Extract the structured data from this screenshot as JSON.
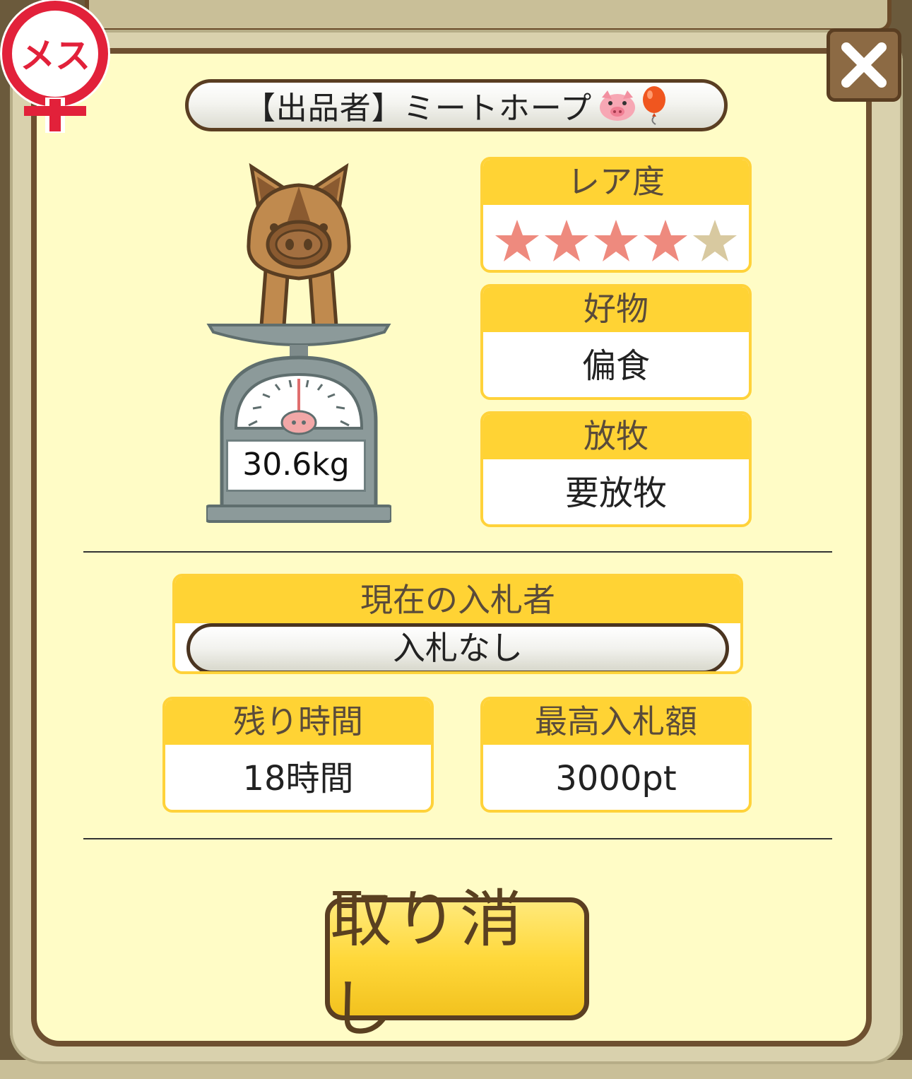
{
  "seller": {
    "label": "【出品者】ミートホープ"
  },
  "gender": {
    "label": "メス"
  },
  "animal": {
    "weight": "30.6kg"
  },
  "rarity": {
    "title": "レア度",
    "stars_filled": 4,
    "stars_total": 5
  },
  "favorite": {
    "title": "好物",
    "value": "偏食"
  },
  "grazing": {
    "title": "放牧",
    "value": "要放牧"
  },
  "bidder": {
    "title": "現在の入札者",
    "value": "入札なし"
  },
  "time_left": {
    "title": "残り時間",
    "value": "18時間"
  },
  "max_bid": {
    "title": "最高入札額",
    "value": "3000pt"
  },
  "actions": {
    "cancel_label": "取り消し"
  },
  "colors": {
    "header_yellow": "#ffd334",
    "border_brown": "#6e5030",
    "star_filled": "#ee8a7e",
    "star_empty": "#d8c9a0"
  }
}
